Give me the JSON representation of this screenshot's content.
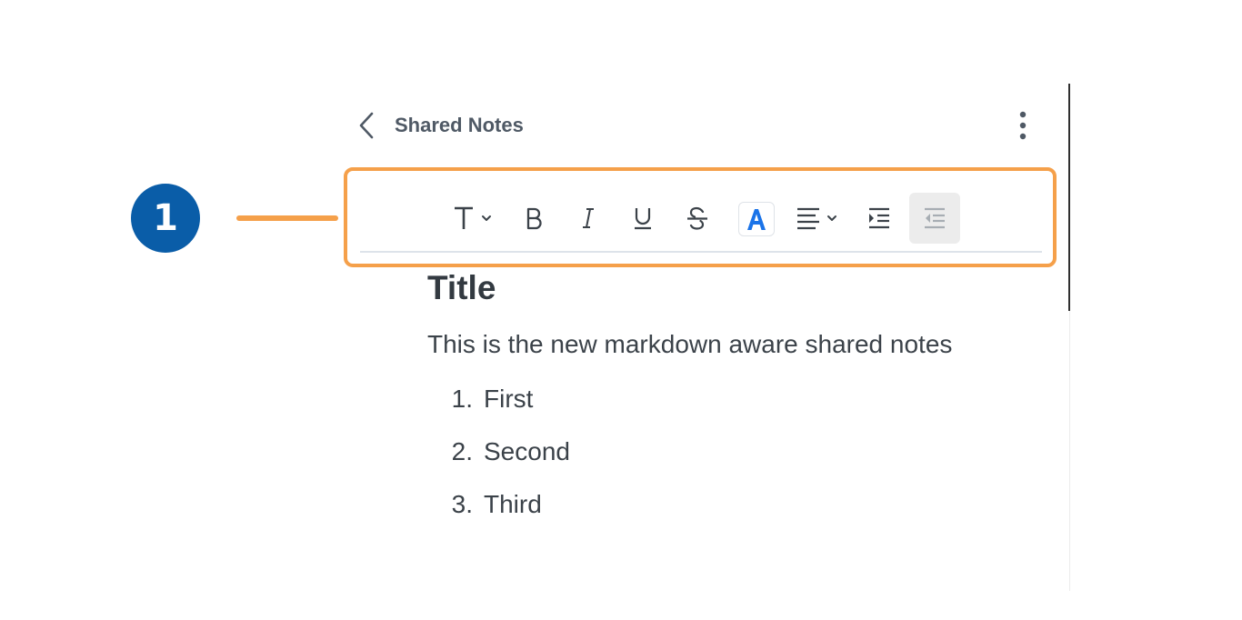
{
  "callout": {
    "number": "1",
    "accent_color": "#f5a04a",
    "badge_color": "#0a5da8"
  },
  "header": {
    "back_icon": "chevron-left-icon",
    "title": "Shared Notes",
    "more_icon": "vertical-ellipsis-icon"
  },
  "toolbar": {
    "items": [
      {
        "name": "text-style",
        "icon": "text-type-icon",
        "dropdown": true
      },
      {
        "name": "bold",
        "icon": "bold-icon",
        "dropdown": false
      },
      {
        "name": "italic",
        "icon": "italic-icon",
        "dropdown": false
      },
      {
        "name": "underline",
        "icon": "underline-icon",
        "dropdown": false
      },
      {
        "name": "strikethrough",
        "icon": "strikethrough-icon",
        "dropdown": false
      },
      {
        "name": "font-color",
        "icon": "font-color-icon",
        "dropdown": false,
        "color": "#1a73e8"
      },
      {
        "name": "align",
        "icon": "align-left-icon",
        "dropdown": true
      },
      {
        "name": "indent",
        "icon": "indent-icon",
        "dropdown": false
      },
      {
        "name": "outdent",
        "icon": "outdent-icon",
        "dropdown": false,
        "active": true
      }
    ]
  },
  "document": {
    "title": "Title",
    "paragraph": "This is the new markdown aware shared notes",
    "list": [
      {
        "number": "1.",
        "text": "First"
      },
      {
        "number": "2.",
        "text": "Second"
      },
      {
        "number": "3.",
        "text": "Third"
      }
    ]
  }
}
